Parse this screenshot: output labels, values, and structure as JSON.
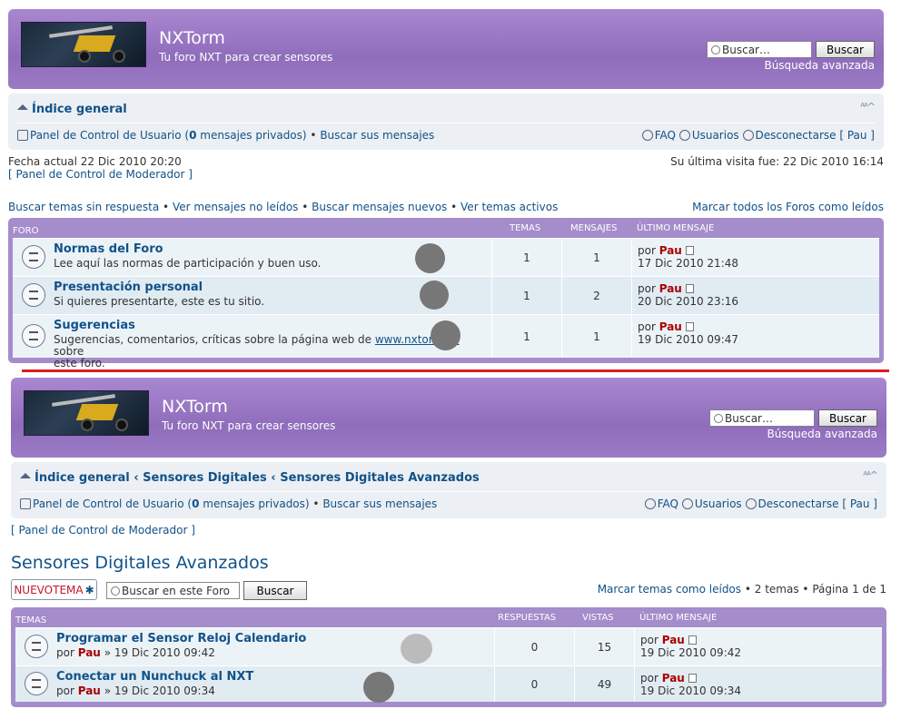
{
  "header": {
    "site_name": "NXTorm",
    "site_desc": "Tu foro NXT para crear sensores",
    "search_placeholder": "Buscar…",
    "search_button": "Buscar",
    "advanced_search": "Búsqueda avanzada"
  },
  "top": {
    "breadcrumb": {
      "home": "Índice general"
    },
    "ucp": "Panel de Control de Usuario (",
    "pm_count": "0",
    "pm_text": " mensajes privados)",
    "sep": "•",
    "search_own": "Buscar sus mensajes",
    "faq": "FAQ",
    "users": "Usuarios",
    "logout": "Desconectarse [ Pau ]",
    "current_date": "Fecha actual 22 Dic 2010 20:20",
    "mcp": "[ Panel de Control de Moderador ]",
    "last_visit": "Su última visita fue: 22 Dic 2010 16:14",
    "links": [
      "Buscar temas sin respuesta",
      "Ver mensajes no leídos",
      "Buscar mensajes nuevos",
      "Ver temas activos"
    ],
    "mark_forums": "Marcar todos los Foros como leídos",
    "table_head": {
      "forum": "FORO",
      "topics": "TEMAS",
      "posts": "MENSAJES",
      "last": "ÚLTIMO MENSAJE"
    },
    "forums": [
      {
        "title": "Normas del Foro",
        "desc": "Lee aquí las normas de participación y buen uso.",
        "topics": "1",
        "posts": "1",
        "by": "por",
        "author": "Pau",
        "date": "17 Dic 2010 21:48"
      },
      {
        "title": "Presentación personal",
        "desc": "Si quieres presentarte, este es tu sitio.",
        "topics": "1",
        "posts": "2",
        "by": "por",
        "author": "Pau",
        "date": "20 Dic 2010 23:16"
      },
      {
        "title": "Sugerencias",
        "desc_a": "Sugerencias, comentarios, críticas sobre la página web de ",
        "desc_link": "www.nxtorm.es",
        "desc_b": " sobre",
        "desc_c": "este foro.",
        "topics": "1",
        "posts": "1",
        "by": "por",
        "author": "Pau",
        "date": "19 Dic 2010 09:47"
      }
    ]
  },
  "bottom": {
    "breadcrumb": {
      "home": "Índice general",
      "c1": "Sensores Digitales",
      "c2": "Sensores Digitales Avanzados"
    },
    "mcp": "[ Panel de Control de Moderador ]",
    "forum_title": "Sensores Digitales Avanzados",
    "new_topic": "NUEVOTEMA",
    "search_forum_placeholder": "Buscar en este Foro",
    "search_button": "Buscar",
    "mark_topics": "Marcar temas como leídos",
    "topic_count": "2 temas",
    "pagination": "Página 1 de 1",
    "table_head": {
      "topics": "TEMAS",
      "replies": "RESPUESTAS",
      "views": "VISTAS",
      "last": "ÚLTIMO MENSAJE"
    },
    "topics": [
      {
        "title": "Programar el Sensor Reloj Calendario",
        "by": "por",
        "author": "Pau",
        "date": "» 19 Dic 2010 09:42",
        "replies": "0",
        "views": "15",
        "last_author": "Pau",
        "last_date": "19 Dic 2010 09:42"
      },
      {
        "title": "Conectar un Nunchuck al NXT",
        "by": "por",
        "author": "Pau",
        "date": "» 19 Dic 2010 09:34",
        "replies": "0",
        "views": "49",
        "last_author": "Pau",
        "last_date": "19 Dic 2010 09:34"
      }
    ]
  },
  "colors": {
    "header": "#9b7ac6",
    "nav_bg": "#eceff3",
    "link": "#105289",
    "author": "#aa0000",
    "separator": "#e11b22"
  }
}
